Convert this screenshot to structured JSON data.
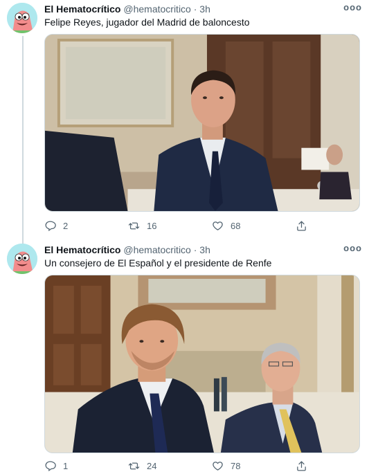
{
  "tweets": [
    {
      "author_name": "El Hematocrítico",
      "handle": "@hematocritico",
      "separator": "·",
      "time": "3h",
      "more_label": "ooo",
      "text": "Felipe Reyes, jugador del Madrid de baloncesto",
      "replies": "2",
      "retweets": "16",
      "likes": "68"
    },
    {
      "author_name": "El Hematocrítico",
      "handle": "@hematocritico",
      "separator": "·",
      "time": "3h",
      "more_label": "ooo",
      "text": "Un consejero de El Español y el presidente de Renfe",
      "replies": "1",
      "retweets": "24",
      "likes": "78"
    }
  ],
  "icons": {
    "reply": "reply-icon",
    "retweet": "retweet-icon",
    "like": "heart-icon",
    "share": "share-icon",
    "avatar": "cartoon-avatar"
  },
  "colors": {
    "text": "#0f1419",
    "secondary": "#536471",
    "thread_line": "#cfd9de",
    "avatar_bg": "#aee8ee"
  }
}
